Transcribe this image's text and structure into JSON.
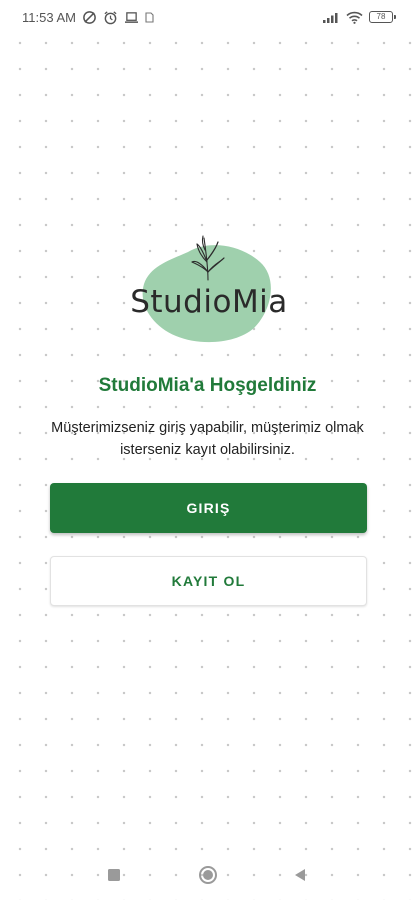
{
  "status_bar": {
    "time": "11:53 AM",
    "left_icons": [
      "do-not-disturb-icon",
      "alarm-icon",
      "laptop-icon",
      "notification-icon"
    ],
    "right_icons": [
      "signal-icon",
      "wifi-icon",
      "battery-icon"
    ],
    "battery_level": "78"
  },
  "logo": {
    "text": "StudioMia",
    "blob_color": "#9fd0ad",
    "icon": "leaf-sprig-icon"
  },
  "welcome": {
    "title": "StudioMia'a Hoşgeldiniz",
    "description": "Müşterimizseniz giriş yapabilir, müşterimiz olmak isterseniz kayıt olabilirsiniz."
  },
  "buttons": {
    "login_label": "GIRIŞ",
    "register_label": "KAYIT OL"
  },
  "colors": {
    "brand_green": "#217a3a",
    "logo_blob": "#9fd0ad"
  },
  "nav_bar": {
    "icons": [
      "recents-square-icon",
      "home-circle-icon",
      "back-triangle-icon"
    ]
  }
}
